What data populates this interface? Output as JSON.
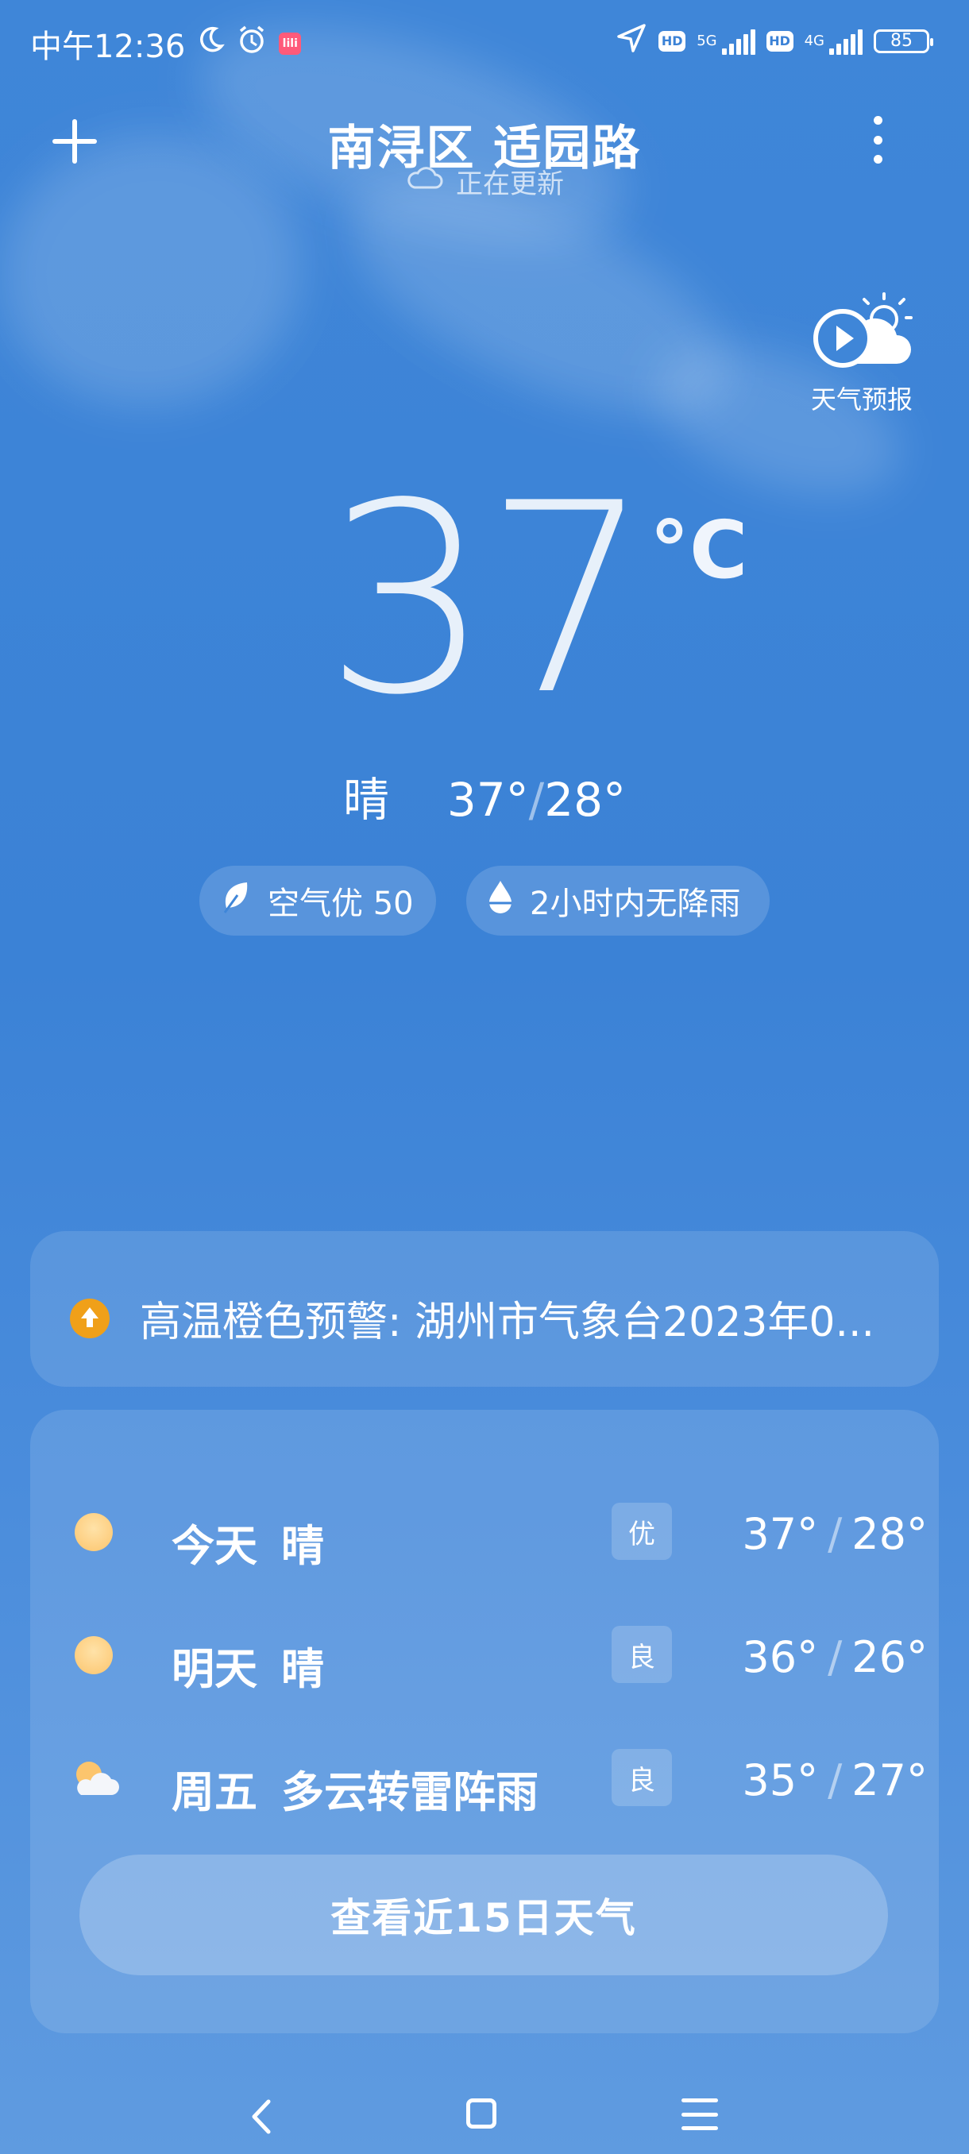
{
  "status_bar": {
    "time": "中午12:36",
    "app_badge": "lili",
    "net1": "5G",
    "hd1": "HD",
    "net2": "4G",
    "hd2": "HD",
    "battery": "85",
    "icons": [
      "moon-icon",
      "alarm-icon",
      "app-badge-icon",
      "location-arrow-icon",
      "signal-icon",
      "battery-icon"
    ]
  },
  "header": {
    "location": "南浔区 适园路",
    "update_status": "正在更新",
    "add_icon": "plus-icon",
    "menu_icon": "more-vertical-icon"
  },
  "forecast_button": {
    "label": "天气预报",
    "icon": "weather-video-icon"
  },
  "current": {
    "temperature": "37",
    "unit": "°C",
    "condition": "晴",
    "high": "37°",
    "low": "28°"
  },
  "pills": {
    "air_quality": "空气优 50",
    "rain": "2小时内无降雨"
  },
  "alert": {
    "text": "高温橙色预警: 湖州市气象台2023年0...",
    "color": "#f0a019"
  },
  "daily": [
    {
      "day": "今天",
      "condition": "晴",
      "aqi": "优",
      "high": "37°",
      "low": "28°",
      "icon": "sun-icon"
    },
    {
      "day": "明天",
      "condition": "晴",
      "aqi": "良",
      "high": "36°",
      "low": "26°",
      "icon": "sun-icon"
    },
    {
      "day": "周五",
      "condition": "多云转雷阵雨",
      "aqi": "良",
      "high": "35°",
      "low": "27°",
      "icon": "partly-cloudy-icon"
    }
  ],
  "cta_label": "查看近15日天气",
  "colors": {
    "background": "#3f86d8",
    "alert": "#f0a019",
    "sun": "#fcc56d"
  }
}
